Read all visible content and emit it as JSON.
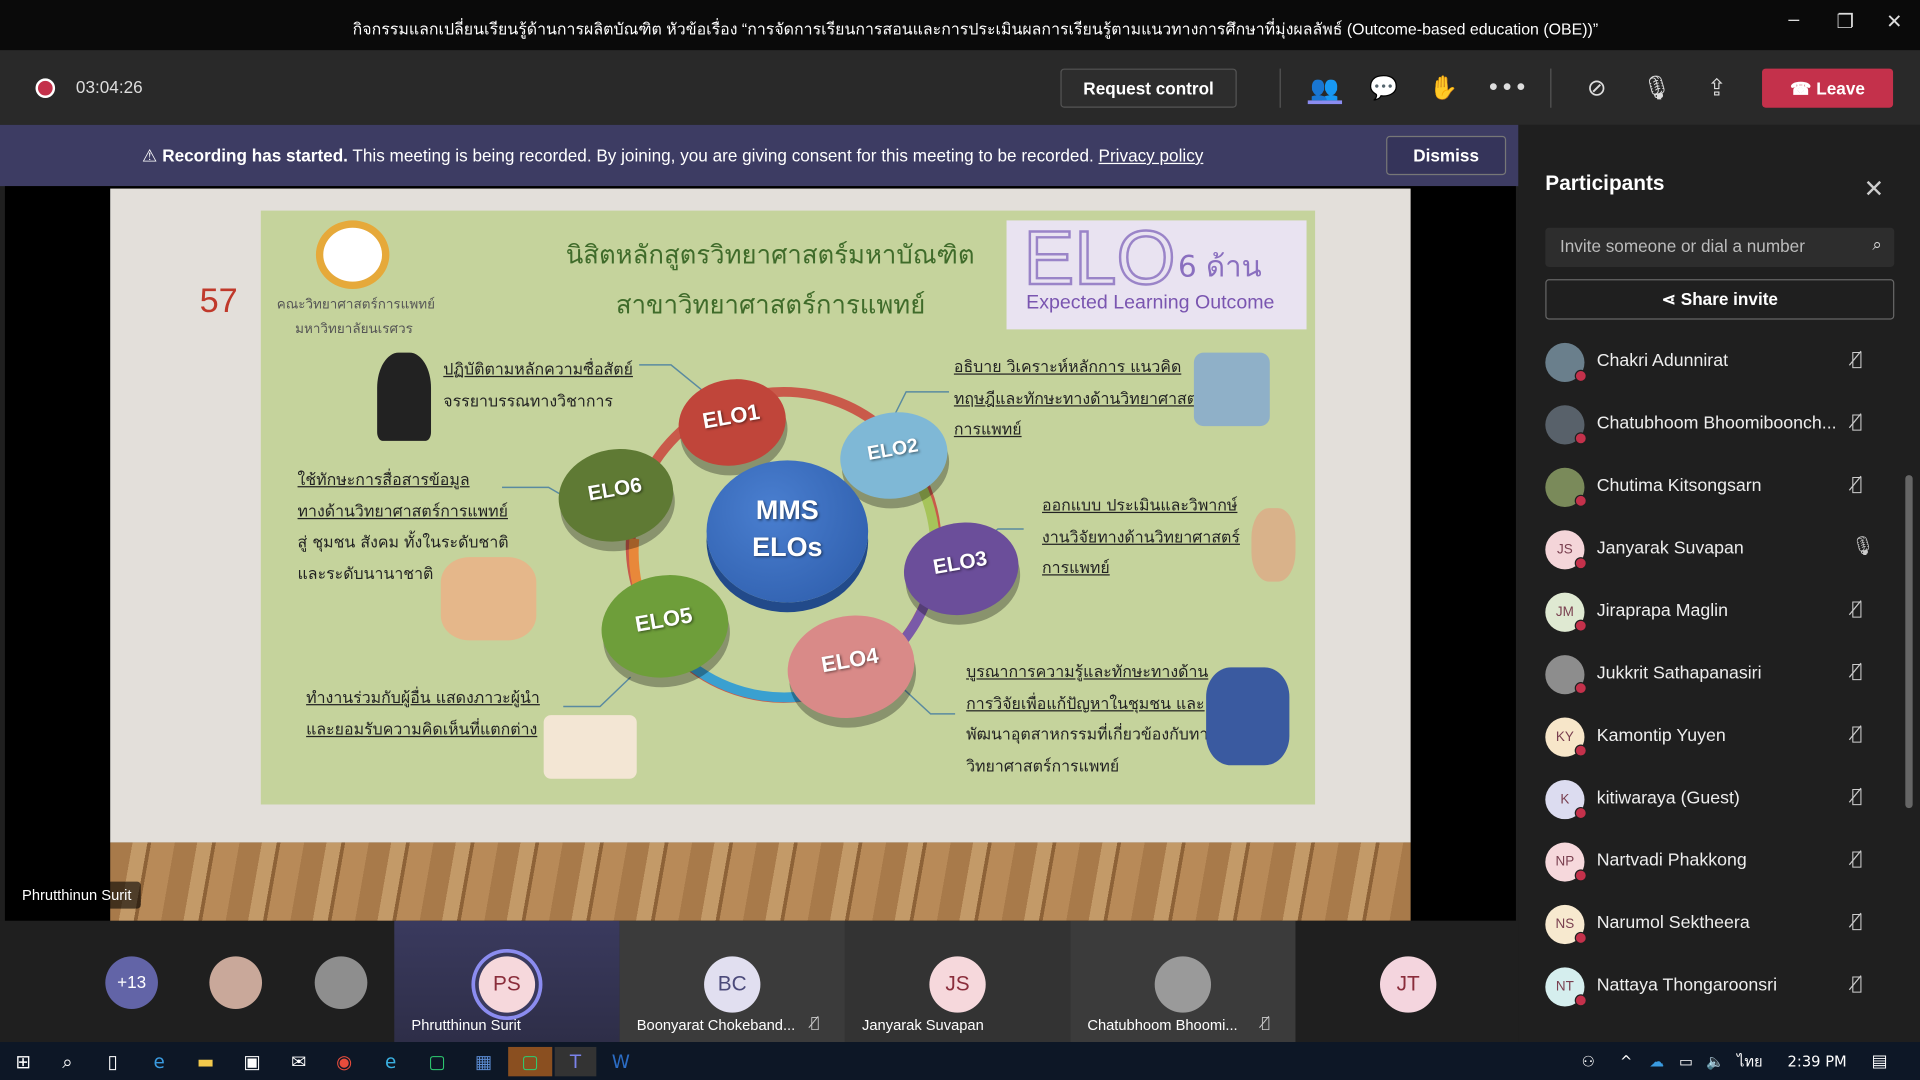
{
  "window": {
    "title": "กิจกรรมแลกเปลี่ยนเรียนรู้ด้านการผลิตบัณฑิต หัวข้อเรื่อง “การจัดการเรียนการสอนและการประเมินผลการเรียนรู้ตามแนวทางการศึกษาที่มุ่งผลลัพธ์ (Outcome-based education (OBE))”"
  },
  "controls": {
    "timer": "03:04:26",
    "request_control": "Request control",
    "leave": "Leave",
    "icons": [
      "participants-icon",
      "chat-icon",
      "reactions-icon",
      "more-icon",
      "camera-off-icon",
      "mic-off-icon",
      "share-tray-icon"
    ]
  },
  "banner": {
    "bold": "Recording has started.",
    "text": "This meeting is being recorded. By joining, you are giving consent for this meeting to be recorded.",
    "link": "Privacy policy",
    "dismiss": "Dismiss"
  },
  "slide": {
    "number": "57",
    "faculty": [
      "คณะวิทยาศาสตร์การแพทย์",
      "มหาวิทยาลัยนเรศวร"
    ],
    "title": [
      "นิสิตหลักสูตรวิทยาศาสตร์มหาบัณฑิต",
      "สาขาวิทยาศาสตร์การแพทย์"
    ],
    "elo_box": {
      "big": "ELO",
      "count": "6 ด้าน",
      "subtitle": "Expected Learning Outcome"
    },
    "center": [
      "MMS",
      "ELOs"
    ],
    "elos": [
      {
        "label": "ELO1",
        "color": "#c0453a",
        "text": [
          "ปฏิบัติตามหลักความซื่อสัตย์",
          "จรรยาบรรณทางวิชาการ"
        ]
      },
      {
        "label": "ELO2",
        "color": "#7fb8d6",
        "text": [
          "อธิบาย  วิเคราะห์หลักการ  แนวคิด",
          "ทฤษฎีและทักษะทางด้านวิทยาศาสตร์",
          "การแพทย์"
        ]
      },
      {
        "label": "ELO3",
        "color": "#6b4e9a",
        "text": [
          "ออกแบบ  ประเมินและวิพากษ์",
          "งานวิจัยทางด้านวิทยาศาสตร์",
          "การแพทย์"
        ]
      },
      {
        "label": "ELO4",
        "color": "#d98a88",
        "text": [
          "บูรณาการความรู้และทักษะทางด้าน",
          "การวิจัยเพื่อแก้ปัญหาในชุมชน  และ",
          "พัฒนาอุตสาหกรรมที่เกี่ยวข้องกับทาง",
          "วิทยาศาสตร์การแพทย์"
        ]
      },
      {
        "label": "ELO5",
        "color": "#6e9e3a",
        "text": [
          "ทำงานร่วมกับผู้อื่น  แสดงภาวะผู้นำ",
          "และยอมรับความคิดเห็นที่แตกต่าง"
        ]
      },
      {
        "label": "ELO6",
        "color": "#5f7a34",
        "text": [
          "ใช้ทักษะการสื่อสารข้อมูล",
          "ทางด้านวิทยาศาสตร์การแพทย์",
          "สู่ ชุมชน  สังคม ทั้งในระดับชาติ",
          "และระดับนานาชาติ"
        ]
      }
    ],
    "presenter_label": "Phrutthinun Surit"
  },
  "strip": {
    "overflow": "+13",
    "tiles": [
      {
        "initials": "PS",
        "name": "Phrutthinun Surit",
        "muted": false
      },
      {
        "initials": "BC",
        "name": "Boonyarat Chokeband...",
        "muted": true
      },
      {
        "initials": "JS",
        "name": "Janyarak Suvapan",
        "muted": false
      },
      {
        "initials": "",
        "name": "Chatubhoom Bhoomi...",
        "muted": true
      },
      {
        "initials": "JT",
        "name": "",
        "muted": false
      }
    ]
  },
  "panel": {
    "title": "Participants",
    "invite_placeholder": "Invite someone or dial a number",
    "share_invite": "Share invite",
    "participants": [
      {
        "name": "Chakri Adunnirat",
        "initials": "",
        "muted": true,
        "color": "#6a7f8c"
      },
      {
        "name": "Chatubhoom Bhoomiboonch...",
        "initials": "",
        "muted": true,
        "color": "#58616a"
      },
      {
        "name": "Chutima Kitsongsarn",
        "initials": "",
        "muted": true,
        "color": "#7a8a5a"
      },
      {
        "name": "Janyarak Suvapan",
        "initials": "JS",
        "muted": false,
        "color": "#f4d5d9"
      },
      {
        "name": "Jiraprapa Maglin",
        "initials": "JM",
        "muted": true,
        "color": "#dfe9d2"
      },
      {
        "name": "Jukkrit Sathapanasiri",
        "initials": "",
        "muted": true,
        "color": "#8d8d8d"
      },
      {
        "name": "Kamontip Yuyen",
        "initials": "KY",
        "muted": true,
        "color": "#f7e6c9"
      },
      {
        "name": "kitiwaraya (Guest)",
        "initials": "K",
        "muted": true,
        "color": "#dcdcf0"
      },
      {
        "name": "Nartvadi Phakkong",
        "initials": "NP",
        "muted": true,
        "color": "#f6d8dc"
      },
      {
        "name": "Narumol Sektheera",
        "initials": "NS",
        "muted": true,
        "color": "#f7e9cf"
      },
      {
        "name": "Nattaya Thongaroonsri",
        "initials": "NT",
        "muted": true,
        "color": "#d5eeee"
      }
    ]
  },
  "taskbar": {
    "lang": "ไทย",
    "time": "2:39 PM"
  }
}
